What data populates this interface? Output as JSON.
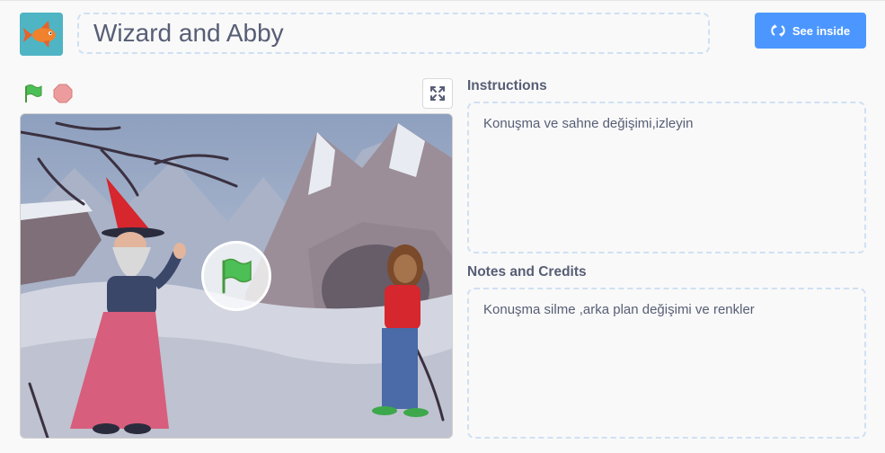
{
  "project": {
    "title": "Wizard and Abby",
    "see_inside_label": "See inside"
  },
  "icons": {
    "thumbnail": "goldfish-thumbnail",
    "see_inside": "remix-arrows-icon",
    "green_flag": "green-flag-icon",
    "stop": "stop-sign-icon",
    "fullscreen": "fullscreen-expand-icon",
    "play_overlay": "green-flag-play-icon"
  },
  "instructions": {
    "heading": "Instructions",
    "text": "Konuşma ve sahne değişimi,izleyin"
  },
  "notes": {
    "heading": "Notes and Credits",
    "text": "Konuşma silme ,arka plan değişimi ve renkler"
  },
  "colors": {
    "accent": "#4c97ff",
    "flag_green": "#4cbf56",
    "stop_red": "#ec9c9c",
    "text": "#575e75"
  }
}
